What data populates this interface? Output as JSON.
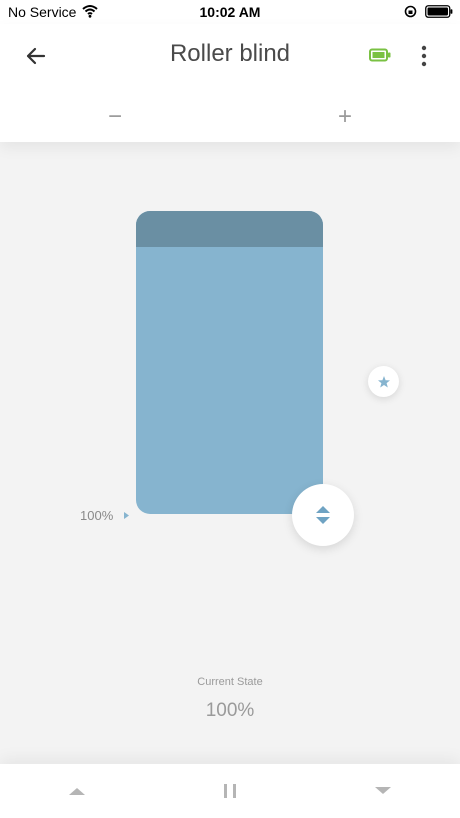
{
  "status_bar": {
    "carrier": "No Service",
    "time": "10:02 AM",
    "icons": [
      "wifi-icon",
      "rotation-lock-icon",
      "battery-icon"
    ]
  },
  "header": {
    "title": "Roller blind",
    "back_icon": "arrow-left-icon",
    "device_battery_icon": "battery-icon",
    "device_battery_color": "#7ac143",
    "more_icon": "more-vertical-icon",
    "step_minus": "−",
    "step_plus": "+"
  },
  "blind": {
    "position_label": "100%",
    "fabric_color": "#86b4cf",
    "roller_color": "#6a8fa3",
    "favorite_icon": "star-icon",
    "drag_icon": "up-down-arrows-icon"
  },
  "state": {
    "label": "Current State",
    "value": "100%"
  },
  "controls": {
    "open_icon": "triangle-up-icon",
    "pause_icon": "pause-icon",
    "close_icon": "triangle-down-icon"
  }
}
